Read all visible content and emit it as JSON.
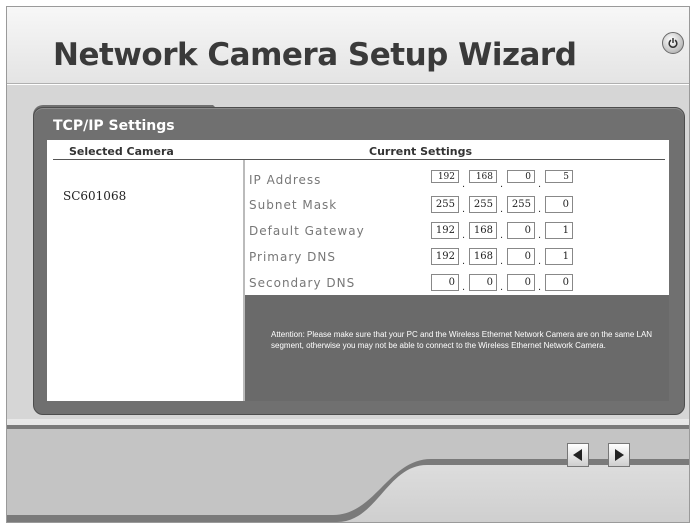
{
  "header": {
    "title": "Network Camera Setup Wizard"
  },
  "panel": {
    "tab_label": "TCP/IP Settings"
  },
  "columns": {
    "selected_camera": "Selected Camera",
    "current_settings": "Current Settings"
  },
  "camera": {
    "name": "SC601068"
  },
  "settings": [
    {
      "label": "IP Address",
      "octets": [
        "192",
        "168",
        "0",
        "5"
      ]
    },
    {
      "label": "Subnet Mask",
      "octets": [
        "255",
        "255",
        "255",
        "0"
      ]
    },
    {
      "label": "Default Gateway",
      "octets": [
        "192",
        "168",
        "0",
        "1"
      ]
    },
    {
      "label": "Primary DNS",
      "octets": [
        "192",
        "168",
        "0",
        "1"
      ]
    },
    {
      "label": "Secondary DNS",
      "octets": [
        "0",
        "0",
        "0",
        "0"
      ]
    }
  ],
  "separator": ".",
  "attention": "Attention: Please make sure that your PC and the Wireless Ethernet Network Camera are on the same LAN segment, otherwise you may not be able to connect to the Wireless Ethernet Network Camera.",
  "icons": {
    "power": "power-icon",
    "back": "left-arrow-icon",
    "next": "right-arrow-icon"
  },
  "colors": {
    "panel": "#707070",
    "title": "#3a3a3a"
  }
}
